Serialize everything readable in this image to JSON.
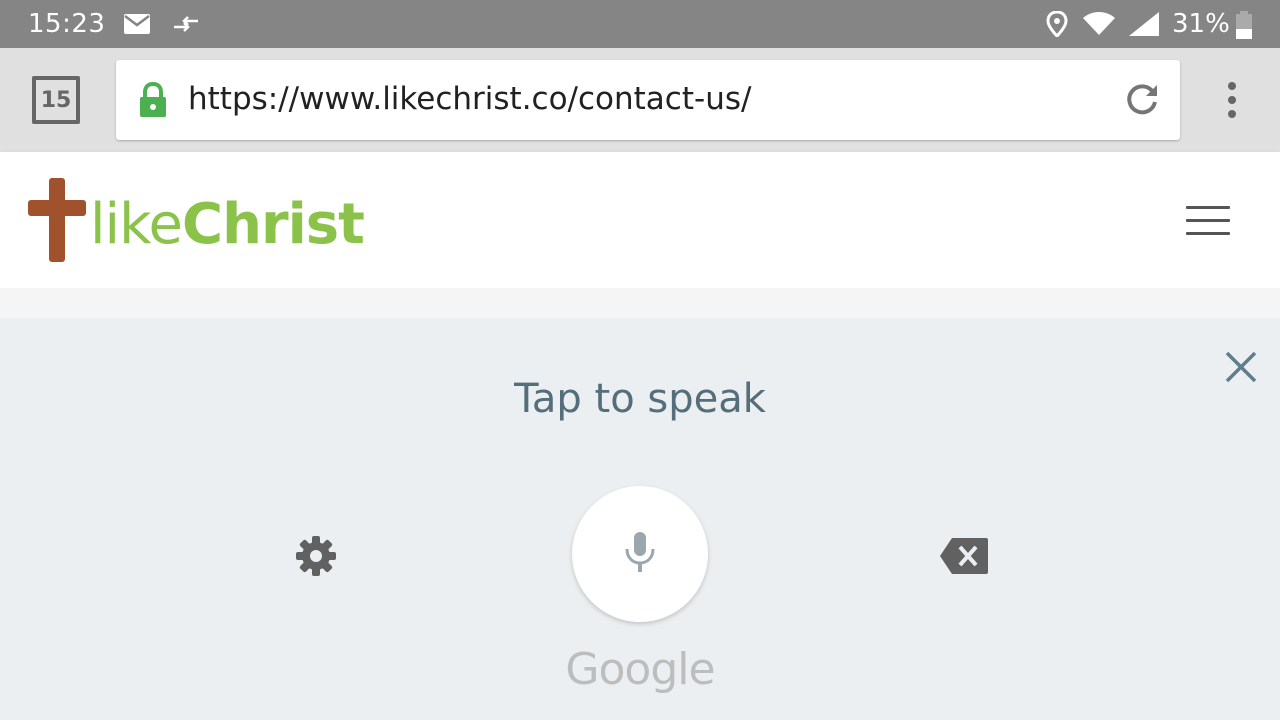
{
  "status_bar": {
    "time": "15:23",
    "battery_percent": "31%",
    "icons": [
      "mail-icon",
      "data-transfer-icon",
      "location-icon",
      "wifi-icon",
      "signal-icon",
      "battery-icon"
    ]
  },
  "browser": {
    "tab_count": "15",
    "url": "https://www.likechrist.co/contact-us/",
    "secure": true,
    "icons": [
      "lock-icon",
      "reload-icon",
      "overflow-menu-icon"
    ]
  },
  "site": {
    "logo_light": "like",
    "logo_bold": "Christ",
    "logo_color": "#8bc34a",
    "cross_color": "#a0522d",
    "menu_icon": "hamburger-icon"
  },
  "voice_input": {
    "prompt": "Tap to speak",
    "brand": "Google",
    "icons": [
      "close-icon",
      "settings-icon",
      "microphone-icon",
      "backspace-icon"
    ]
  }
}
